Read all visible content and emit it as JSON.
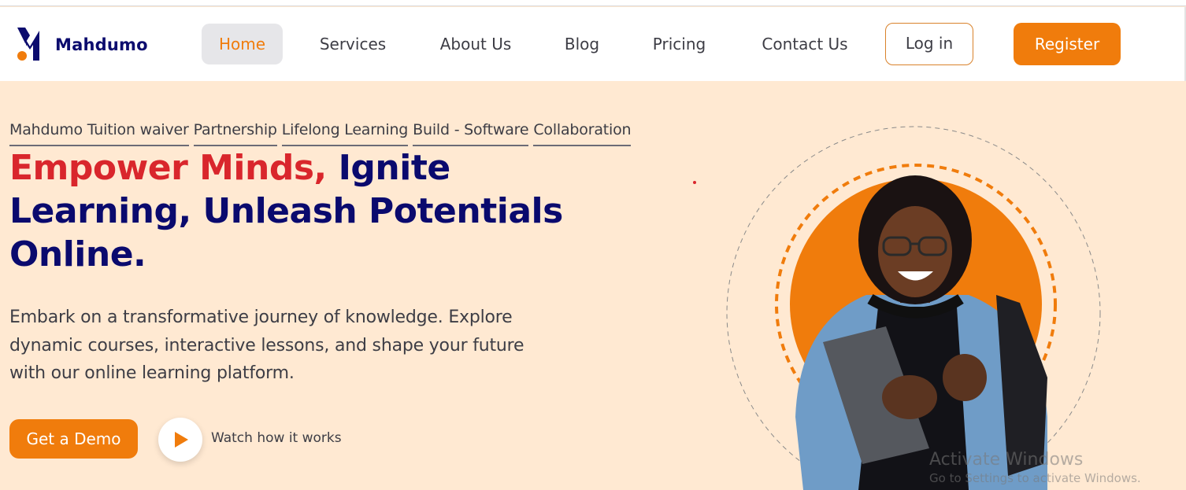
{
  "brand": {
    "name": "Mahdumo",
    "accent": "#f07c0c",
    "navy": "#0a0a6e",
    "red": "#d9262c",
    "hero_bg": "#ffe9d2"
  },
  "nav": {
    "items": [
      {
        "label": "Home",
        "active": true
      },
      {
        "label": "Services"
      },
      {
        "label": "About Us"
      },
      {
        "label": "Blog"
      },
      {
        "label": "Pricing"
      },
      {
        "label": "Contact Us"
      }
    ],
    "login": "Log in",
    "register": "Register"
  },
  "hero": {
    "tags": [
      "Mahdumo Tuition waiver",
      "Partnership",
      "Lifelong Learning",
      "Build - Software",
      "Collaboration"
    ],
    "headline_red": "Empower Minds,",
    "headline_rest": "Ignite Learning, Unleash Potentials Online.",
    "description": "Embark on a transformative journey of knowledge. Explore dynamic courses, interactive lessons, and shape your future with our online learning platform.",
    "demo_button": "Get a Demo",
    "watch_label": "Watch how it works"
  },
  "watermark": {
    "line1": "Activate Windows",
    "line2": "Go to Settings to activate Windows."
  }
}
